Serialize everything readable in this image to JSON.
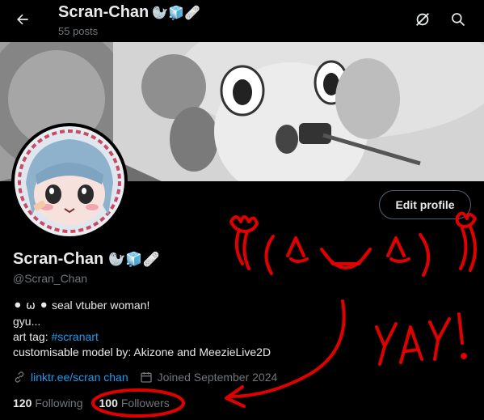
{
  "header": {
    "title": "Scran-Chan",
    "title_emoji": "🦭🧊🩹",
    "post_count": "55 posts"
  },
  "profile": {
    "display_name": "Scran-Chan",
    "name_emoji": "🦭🧊🩹",
    "handle": "@Scran_Chan",
    "edit_label": "Edit profile"
  },
  "bio": {
    "line1_emoji": "⚫ ω ⚫",
    "line1_text": "seal vtuber woman!",
    "line2": "gyu...",
    "line3_prefix": "art tag:",
    "line3_hashtag": "#scranart",
    "line4": "customisable model by: Akizone and MeezieLive2D"
  },
  "meta": {
    "link": "linktr.ee/scran chan",
    "joined": "Joined September 2024"
  },
  "stats": {
    "following_count": "120",
    "following_label": "Following",
    "followers_count": "100",
    "followers_label": "Followers"
  },
  "annotation": {
    "text": "YAY!",
    "face": "ʕ(^▽^)ʔ"
  },
  "colors": {
    "accent": "#1d9bf0",
    "scribble": "#e00000",
    "background": "#000000"
  }
}
